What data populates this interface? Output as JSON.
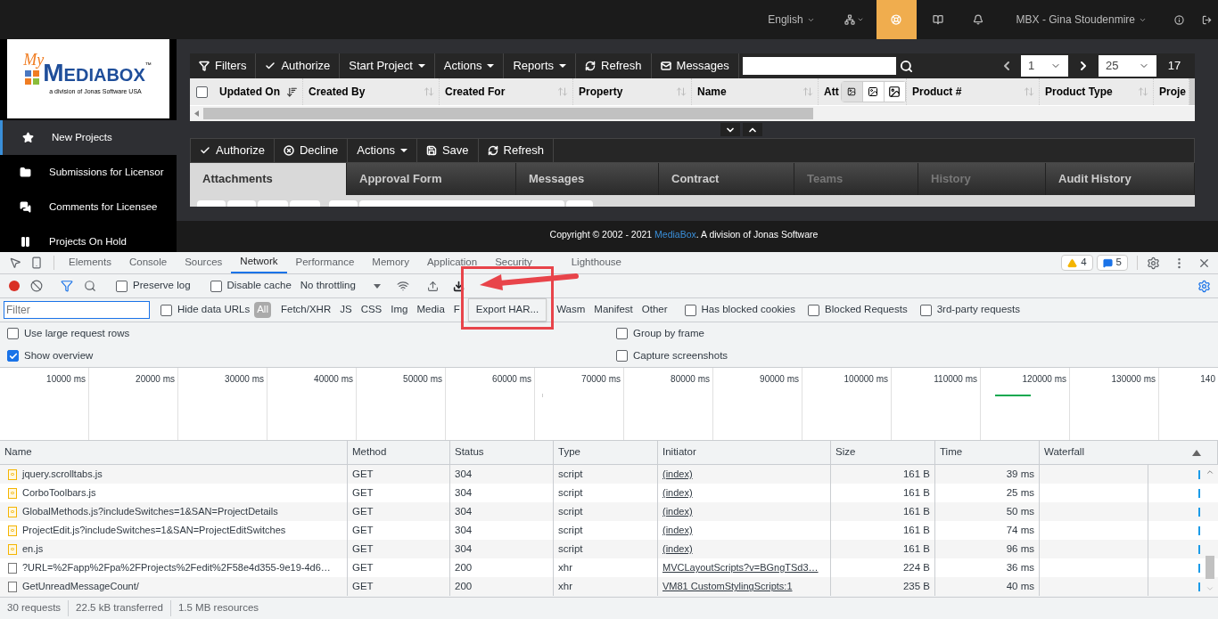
{
  "top_nav": {
    "language": "English",
    "user": "MBX - Gina Stoudenmire",
    "icons": [
      {
        "dropdown": true,
        "selected": false
      },
      {
        "dropdown": false,
        "selected": true
      },
      {
        "dropdown": false,
        "selected": false
      },
      {
        "dropdown": false,
        "selected": false
      }
    ]
  },
  "logo": {
    "script": "My",
    "name": "MEDIABOX",
    "tm": "™",
    "tagline": "a division of Jonas Software USA"
  },
  "sidebar": {
    "items": [
      {
        "label": "New Projects",
        "selected": true
      },
      {
        "label": "Submissions for Licensor",
        "selected": false
      },
      {
        "label": "Comments for Licensee",
        "selected": false
      },
      {
        "label": "Projects On Hold",
        "selected": false
      }
    ]
  },
  "grid_toolbar": {
    "buttons": [
      {
        "label": "Filters",
        "dropdown": false
      },
      {
        "label": "Authorize",
        "dropdown": false
      },
      {
        "label": "Start Project",
        "dropdown": true
      },
      {
        "label": "Actions",
        "dropdown": true
      },
      {
        "label": "Reports",
        "dropdown": true
      },
      {
        "label": "Refresh",
        "dropdown": false
      },
      {
        "label": "Messages",
        "dropdown": false
      }
    ],
    "page": "1",
    "page_size": "25",
    "count": "17"
  },
  "grid": {
    "select_all": false,
    "columns": [
      {
        "label": "Updated On",
        "sorted": true,
        "kind": "text"
      },
      {
        "label": "Created By",
        "sorted": false,
        "kind": "text"
      },
      {
        "label": "Created For",
        "sorted": false,
        "kind": "text"
      },
      {
        "label": "Property",
        "sorted": false,
        "kind": "text"
      },
      {
        "label": "Name",
        "sorted": false,
        "kind": "text"
      },
      {
        "label": "Att",
        "kind": "image-size"
      },
      {
        "label": "Product #",
        "sorted": false,
        "kind": "text"
      },
      {
        "label": "Product Type",
        "sorted": false,
        "kind": "text"
      },
      {
        "label": "Proje",
        "kind": "text"
      }
    ],
    "image_sizes": [
      {
        "selected": true
      },
      {
        "selected": false
      },
      {
        "selected": false
      }
    ]
  },
  "detail_toolbar": {
    "buttons": [
      {
        "label": "Authorize",
        "dropdown": false
      },
      {
        "label": "Decline",
        "dropdown": false
      },
      {
        "label": "Actions",
        "dropdown": true
      },
      {
        "label": "Save",
        "dropdown": false
      },
      {
        "label": "Refresh",
        "dropdown": false
      }
    ]
  },
  "detail_tabs": [
    {
      "label": "Attachments",
      "selected": true,
      "disabled": false
    },
    {
      "label": "Approval Form",
      "selected": false,
      "disabled": false
    },
    {
      "label": "Messages",
      "selected": false,
      "disabled": false
    },
    {
      "label": "Contract",
      "selected": false,
      "disabled": false
    },
    {
      "label": "Teams",
      "selected": false,
      "disabled": true
    },
    {
      "label": "History",
      "selected": false,
      "disabled": true
    },
    {
      "label": "Audit History",
      "selected": false,
      "disabled": false
    }
  ],
  "footer": {
    "prefix": "Copyright © 2002 - 2021 ",
    "link": "MediaBox",
    "suffix": ". A division of Jonas Software"
  },
  "devtools": {
    "tabs": [
      {
        "label": "Elements",
        "selected": false
      },
      {
        "label": "Console",
        "selected": false
      },
      {
        "label": "Sources",
        "selected": false
      },
      {
        "label": "Network",
        "selected": true
      },
      {
        "label": "Performance",
        "selected": false
      },
      {
        "label": "Memory",
        "selected": false
      },
      {
        "label": "Application",
        "selected": false
      },
      {
        "label": "Security",
        "selected": false
      },
      {
        "label": "Lighthouse",
        "selected": false
      }
    ],
    "warnings": "4",
    "messages": "5",
    "recording": true,
    "filter_on": true,
    "preserve_log": {
      "label": "Preserve log",
      "checked": false
    },
    "disable_cache": {
      "label": "Disable cache",
      "checked": false
    },
    "throttling": "No throttling",
    "filter": {
      "placeholder": "Filter"
    },
    "hide_data_urls": {
      "label": "Hide data URLs",
      "checked": false
    },
    "types_before": [
      {
        "label": "All",
        "selected": true
      },
      {
        "label": "Fetch/XHR",
        "selected": false
      },
      {
        "label": "JS",
        "selected": false
      },
      {
        "label": "CSS",
        "selected": false
      },
      {
        "label": "Img",
        "selected": false
      },
      {
        "label": "Media",
        "selected": false
      },
      {
        "label": "F",
        "selected": false
      }
    ],
    "types_after": [
      {
        "label": "Wasm",
        "selected": false
      },
      {
        "label": "Manifest",
        "selected": false
      },
      {
        "label": "Other",
        "selected": false
      }
    ],
    "extra_filters": [
      {
        "label": "Has blocked cookies",
        "checked": false
      },
      {
        "label": "Blocked Requests",
        "checked": false
      },
      {
        "label": "3rd-party requests",
        "checked": false
      }
    ],
    "options_left": [
      {
        "label": "Use large request rows",
        "checked": false
      },
      {
        "label": "Show overview",
        "checked": true
      }
    ],
    "options_right": [
      {
        "label": "Group by frame",
        "checked": false
      },
      {
        "label": "Capture screenshots",
        "checked": false
      }
    ],
    "ticks": [
      "10000 ms",
      "20000 ms",
      "30000 ms",
      "40000 ms",
      "50000 ms",
      "60000 ms",
      "70000 ms",
      "80000 ms",
      "90000 ms",
      "100000 ms",
      "110000 ms",
      "120000 ms",
      "130000 ms",
      "140"
    ],
    "columns": [
      "Name",
      "Method",
      "Status",
      "Type",
      "Initiator",
      "Size",
      "Time",
      "Waterfall"
    ],
    "rows": [
      {
        "kind": "script",
        "name": "jquery.scrolltabs.js",
        "method": "GET",
        "status": "304",
        "type": "script",
        "initiator": "(index)",
        "size": "161 B",
        "time": "39 ms"
      },
      {
        "kind": "script",
        "name": "CorboToolbars.js",
        "method": "GET",
        "status": "304",
        "type": "script",
        "initiator": "(index)",
        "size": "161 B",
        "time": "25 ms"
      },
      {
        "kind": "script",
        "name": "GlobalMethods.js?includeSwitches=1&SAN=ProjectDetails",
        "method": "GET",
        "status": "304",
        "type": "script",
        "initiator": "(index)",
        "size": "161 B",
        "time": "50 ms"
      },
      {
        "kind": "script",
        "name": "ProjectEdit.js?includeSwitches=1&SAN=ProjectEditSwitches",
        "method": "GET",
        "status": "304",
        "type": "script",
        "initiator": "(index)",
        "size": "161 B",
        "time": "74 ms"
      },
      {
        "kind": "script",
        "name": "en.js",
        "method": "GET",
        "status": "304",
        "type": "script",
        "initiator": "(index)",
        "size": "161 B",
        "time": "96 ms"
      },
      {
        "kind": "xhr",
        "name": "?URL=%2Fapp%2Fpa%2FProjects%2Fedit%2F58e4d355-9e19-4d6…",
        "method": "GET",
        "status": "200",
        "type": "xhr",
        "initiator": "MVCLayoutScripts?v=BGngTSd3…",
        "size": "224 B",
        "time": "36 ms"
      },
      {
        "kind": "xhr",
        "name": "GetUnreadMessageCount/",
        "method": "GET",
        "status": "200",
        "type": "xhr",
        "initiator": "VM81 CustomStylingScripts:1",
        "size": "235 B",
        "time": "40 ms"
      }
    ],
    "summary": [
      "30 requests",
      "22.5 kB transferred",
      "1.5 MB resources"
    ],
    "export_tooltip": "Export HAR..."
  }
}
